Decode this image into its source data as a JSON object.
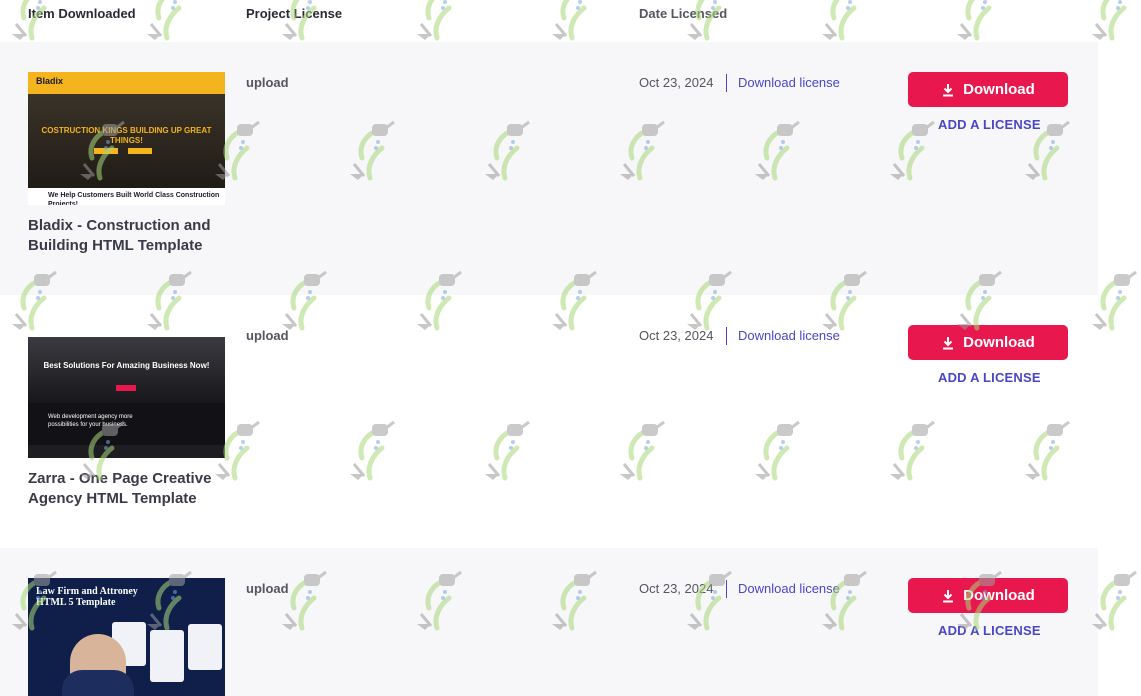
{
  "table": {
    "headers": {
      "item": "Item Downloaded",
      "license": "Project License",
      "date": "Date Licensed"
    },
    "rows": [
      {
        "title": "Bladix - Construction and Building HTML Template",
        "license_type": "upload",
        "date": "Oct 23, 2024",
        "download_license_label": "Download license",
        "download_label": "Download",
        "add_license_label": "ADD A LICENSE",
        "thumbnail": {
          "logo": "Bladix",
          "headline": "COSTRUCTION KINGS BUILDING UP GREAT THINGS!",
          "caption": "We Help Customers Built World Class Construction Projects!"
        }
      },
      {
        "title": "Zarra - One Page Creative Agency HTML Template",
        "license_type": "upload",
        "date": "Oct 23, 2024",
        "download_license_label": "Download license",
        "download_label": "Download",
        "add_license_label": "ADD A LICENSE",
        "thumbnail": {
          "headline": "Best Solutions For Amazing Business Now!",
          "caption": "Web development agency more possibilities for your business."
        }
      },
      {
        "title": "",
        "license_type": "upload",
        "date": "Oct 23, 2024",
        "download_license_label": "Download license",
        "download_label": "Download",
        "add_license_label": "ADD A LICENSE",
        "thumbnail": {
          "headline": "Law Firm and Attroney HTML 5 Template"
        }
      }
    ]
  },
  "colors": {
    "accent_red": "#e8184f",
    "link_purple": "#4a46c8",
    "row_shade": "#f7f7fa"
  },
  "icons": {
    "download_button_icon": "download-arrow-icon",
    "watermark": "watering-can-plant-icon"
  }
}
